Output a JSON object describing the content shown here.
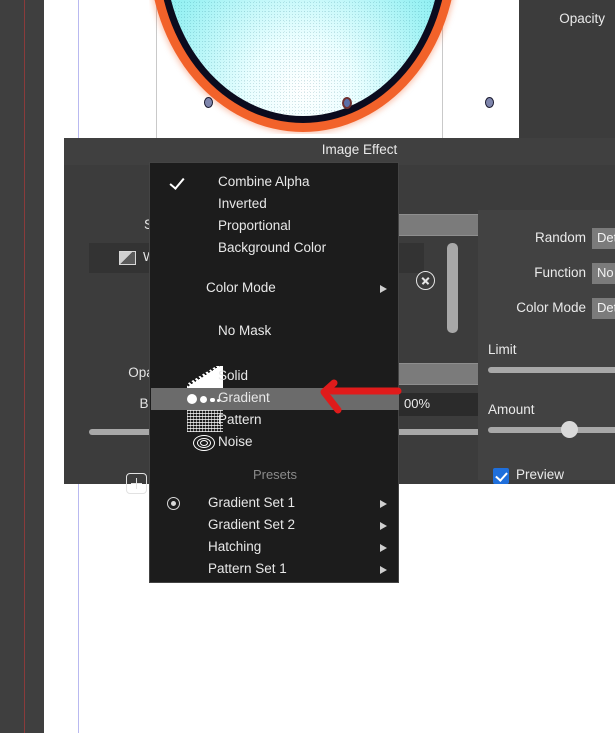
{
  "canvas": {
    "opacity_label": "Opacity",
    "artwork": {
      "name": "gradient-circle",
      "outline_color": "#f2622a",
      "inner_color": "#5ee2e6",
      "core_color": "#ffffff"
    }
  },
  "dialog": {
    "title": "Image Effect",
    "style_label": "Style",
    "style_value": "",
    "swatch_name": "W",
    "opacity_label": "Opacity",
    "blend_label": "Blend",
    "blend_value": "",
    "percent_value": "00%",
    "tools": {
      "add": "+",
      "reset": "↺",
      "history": "◴"
    }
  },
  "right_panel": {
    "random_label": "Random",
    "random_value": "Det",
    "function_label": "Function",
    "function_value": "No",
    "color_mode_label": "Color Mode",
    "color_mode_value": "Det",
    "limit_label": "Limit",
    "amount_label": "Amount",
    "preview_label": "Preview",
    "preview_checked": true,
    "accent_color": "#1f6fdc"
  },
  "context_menu": {
    "items": [
      {
        "label": "Combine Alpha",
        "checked": true,
        "submenu": false,
        "highlighted": false,
        "icon": null
      },
      {
        "label": "Inverted",
        "checked": false,
        "submenu": false,
        "highlighted": false,
        "icon": null
      },
      {
        "label": "Proportional",
        "checked": false,
        "submenu": false,
        "highlighted": false,
        "icon": null
      },
      {
        "label": "Background Color",
        "checked": false,
        "submenu": false,
        "highlighted": false,
        "icon": null
      },
      {
        "label": "Color Mode",
        "checked": false,
        "submenu": true,
        "highlighted": false,
        "icon": null
      },
      {
        "label": "No Mask",
        "checked": false,
        "submenu": false,
        "highlighted": false,
        "icon": null
      },
      {
        "label": "Solid",
        "checked": false,
        "submenu": false,
        "highlighted": false,
        "icon": "solid-fill-icon"
      },
      {
        "label": "Gradient",
        "checked": false,
        "submenu": false,
        "highlighted": true,
        "icon": "gradient-fill-icon"
      },
      {
        "label": "Pattern",
        "checked": false,
        "submenu": false,
        "highlighted": false,
        "icon": "pattern-fill-icon"
      },
      {
        "label": "Noise",
        "checked": false,
        "submenu": false,
        "highlighted": false,
        "icon": "noise-fill-icon"
      }
    ],
    "presets_header": "Presets",
    "presets": [
      {
        "label": "Gradient Set 1",
        "selected": true,
        "submenu": true
      },
      {
        "label": "Gradient Set 2",
        "selected": false,
        "submenu": true
      },
      {
        "label": "Hatching",
        "selected": false,
        "submenu": true
      },
      {
        "label": "Pattern Set 1",
        "selected": false,
        "submenu": true
      }
    ]
  },
  "annotation": {
    "arrow_color": "#e01b1b",
    "points_at": "Gradient"
  }
}
